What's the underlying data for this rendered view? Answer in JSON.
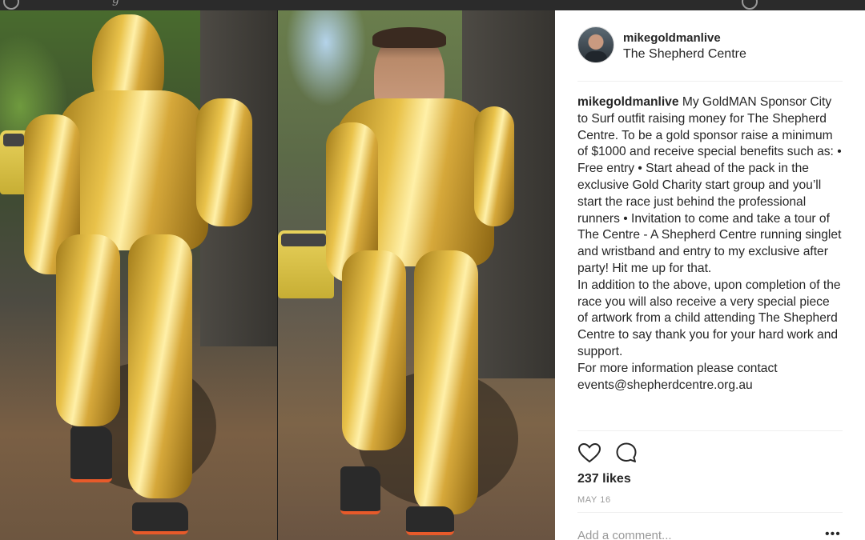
{
  "post": {
    "username": "mikegoldmanlive",
    "location": "The Shepherd Centre",
    "caption_user": "mikegoldmanlive",
    "caption_para1": "My GoldMAN Sponsor City to Surf outfit raising money for The Shepherd Centre. To be a gold sponsor raise a minimum of $1000 and receive special benefits such as: • Free entry • Start ahead of the pack in the exclusive Gold Charity start group and you’ll start the race just behind the professional runners • Invitation to come and take a tour of The Centre - A Shepherd Centre running singlet and wristband and entry to my exclusive after party! Hit me up for that.",
    "caption_para2": "In addition to the above, upon completion of the race you will also receive a very special piece of artwork from a child attending The Shepherd Centre to say thank you for your hard work and support.",
    "caption_para3": "For more information please contact events@shepherdcentre.org.au",
    "likes": "237 likes",
    "date": "MAY 16",
    "add_comment_placeholder": "Add a comment...",
    "more_label": "•••"
  },
  "icons": {
    "like": "heart-icon",
    "comment": "speech-bubble-icon",
    "more": "ellipsis-icon"
  },
  "colors": {
    "text": "#262626",
    "muted": "#999999",
    "separator": "#efefef",
    "suit_gold": "#e9c24a"
  }
}
